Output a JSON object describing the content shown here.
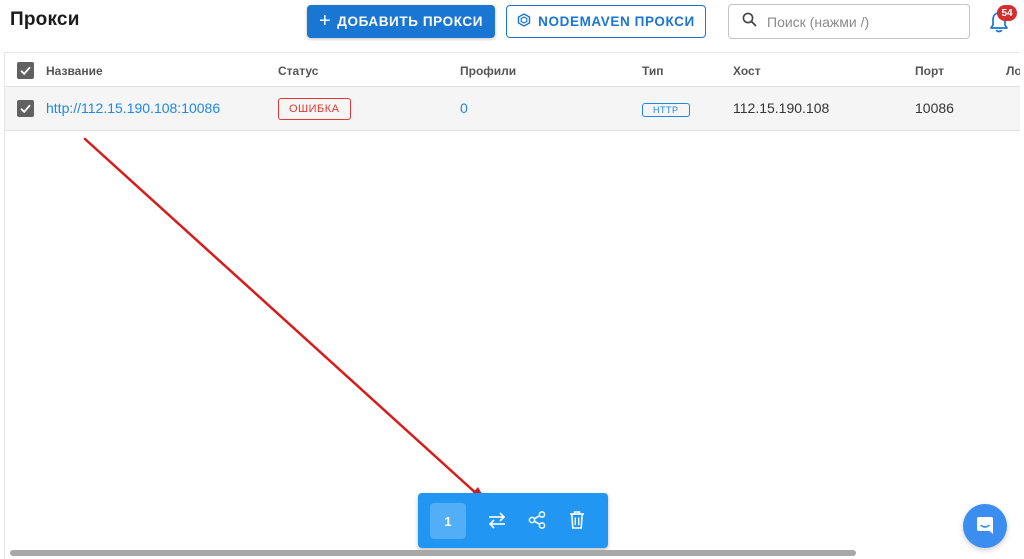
{
  "header": {
    "title": "Прокси",
    "add_button_label": "ДОБАВИТЬ ПРОКСИ",
    "nodemaven_button_label": "NODEMAVEN ПРОКСИ",
    "search_placeholder": "Поиск (нажми /)",
    "notifications_count": "54"
  },
  "table": {
    "columns": [
      "Название",
      "Статус",
      "Профили",
      "Тип",
      "Хост",
      "Порт",
      "Ло"
    ],
    "rows": [
      {
        "name": "http://112.15.190.108:10086",
        "status": "ОШИБКА",
        "profiles": "0",
        "type": "HTTP",
        "host": "112.15.190.108",
        "port": "10086"
      }
    ]
  },
  "bulk_toolbar": {
    "selected_count": "1"
  },
  "colors": {
    "primary": "#1976d2",
    "toolbar": "#2196f3",
    "error": "#e53935",
    "link": "#1e88e5",
    "annotation_arrow": "#d81b1b"
  },
  "icons": [
    "plus-icon",
    "nodemaven-logo-icon",
    "search-icon",
    "bell-icon",
    "checkbox-checked-icon",
    "swap-arrows-icon",
    "share-icon",
    "trash-icon",
    "chat-icon"
  ]
}
